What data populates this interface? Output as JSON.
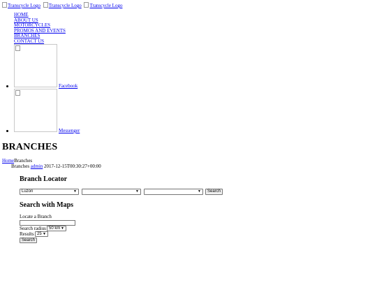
{
  "header": {
    "logos": [
      "Transcycle Logo",
      "Transcycle Logo",
      "Transcycle Logo"
    ]
  },
  "nav": {
    "items": [
      "HOME",
      "ABOUT US",
      "MOTORCYCLES",
      "PROMOS AND EVENTS",
      "BRANCHES",
      "CONTACT US"
    ]
  },
  "social": {
    "items": [
      "Facebook",
      "Messenger"
    ]
  },
  "page": {
    "title": "BRANCHES"
  },
  "breadcrumb": {
    "home": "Home",
    "current": "Branches"
  },
  "meta": {
    "category": "Branches",
    "author": "admin",
    "date": "2017-12-15T00:30:27+00:00"
  },
  "branch_locator": {
    "title": "Branch Locator",
    "region_value": "Luzon",
    "province_value": "",
    "city_value": "",
    "search_label": "Search"
  },
  "maps": {
    "title": "Search with Maps",
    "locate_label": "Locate a Branch",
    "locate_value": "",
    "radius_label": "Search radius",
    "radius_value": "50 km",
    "results_label": "Results",
    "results_value": "25",
    "search_label": "Search"
  }
}
